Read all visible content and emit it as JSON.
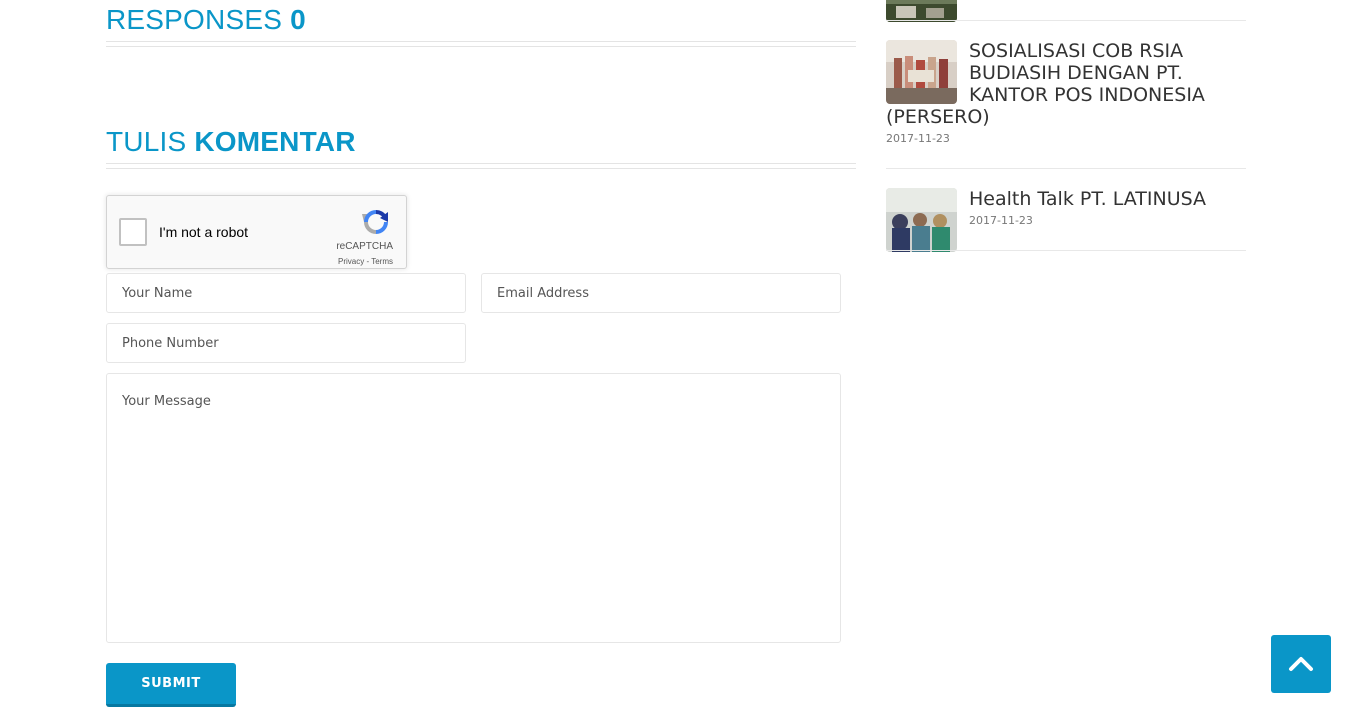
{
  "comments": {
    "responses_label": "RESPONSES",
    "responses_count": "0",
    "comment_heading_light": "TULIS",
    "comment_heading_bold": "KOMENTAR"
  },
  "recaptcha": {
    "label": "I'm not a robot",
    "brand": "reCAPTCHA",
    "privacy": "Privacy",
    "separator": " - ",
    "terms": "Terms"
  },
  "form": {
    "name_placeholder": "Your Name",
    "email_placeholder": "Email Address",
    "phone_placeholder": "Phone Number",
    "message_placeholder": "Your Message",
    "submit_label": "SUBMIT"
  },
  "sidebar": {
    "posts": [
      {
        "title": "SOSIALISASI COB RSIA BUDIASIH DENGAN PT. KANTOR POS INDONESIA (PERSERO)",
        "date": "2017-11-23"
      },
      {
        "title": "Health Talk PT. LATINUSA",
        "date": "2017-11-23"
      }
    ]
  },
  "colors": {
    "accent": "#0a96c8",
    "accent_dark": "#0778a1"
  }
}
